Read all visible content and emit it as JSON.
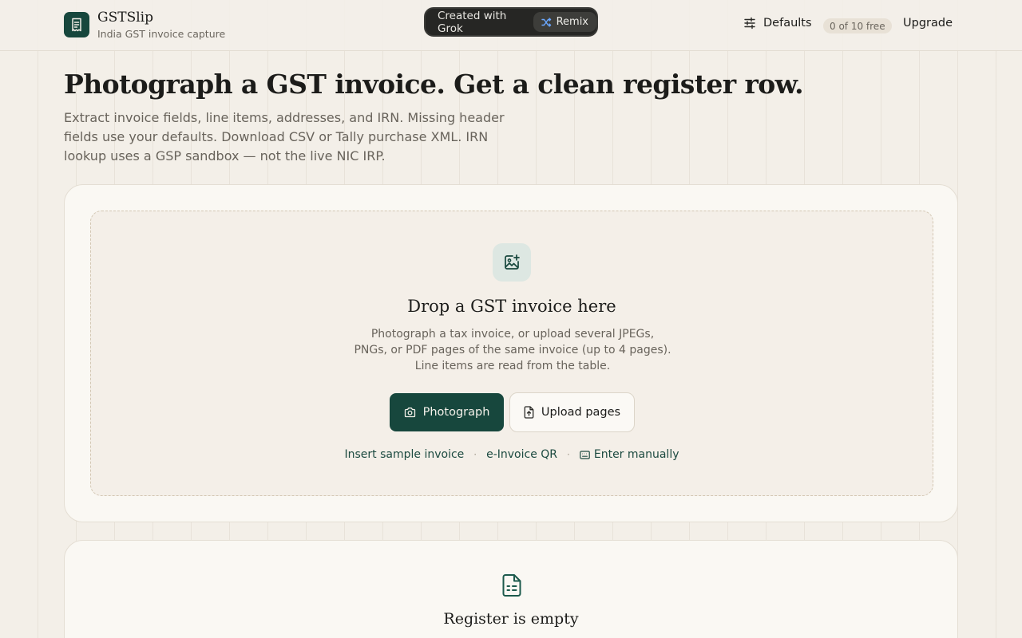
{
  "header": {
    "brand_name": "GSTSlip",
    "brand_sub": "India GST invoice capture",
    "grok_label": "Created with Grok",
    "remix_label": "Remix",
    "defaults_label": "Defaults",
    "free_badge": "0 of 10 free",
    "upgrade_label": "Upgrade"
  },
  "hero": {
    "title": "Photograph a GST invoice. Get a clean register row.",
    "description": "Extract invoice fields, line items, addresses, and IRN. Missing header fields use your defaults. Download CSV or Tally purchase XML. IRN lookup uses a GSP sandbox — not the live NIC IRP."
  },
  "upload": {
    "title": "Drop a GST invoice here",
    "description": "Photograph a tax invoice, or upload several JPEGs, PNGs, or PDF pages of the same invoice (up to 4 pages). Line items are read from the table.",
    "photo_button": "Photograph",
    "upload_button": "Upload pages",
    "links": {
      "sample": "Insert sample invoice",
      "einvoice": "e-Invoice QR",
      "manual": "Enter manually"
    },
    "separator": "·"
  },
  "register": {
    "title": "Register is empty"
  },
  "colors": {
    "accent": "#17473d",
    "background": "#f3efe8",
    "card": "#faf8f3"
  },
  "icons": {
    "logo": "receipt-icon",
    "remix": "shuffle-icon",
    "defaults": "sliders-icon",
    "drop": "image-plus-icon",
    "camera": "camera-icon",
    "file_upload": "file-upload-icon",
    "keyboard": "keyboard-icon",
    "register": "spreadsheet-file-icon"
  }
}
